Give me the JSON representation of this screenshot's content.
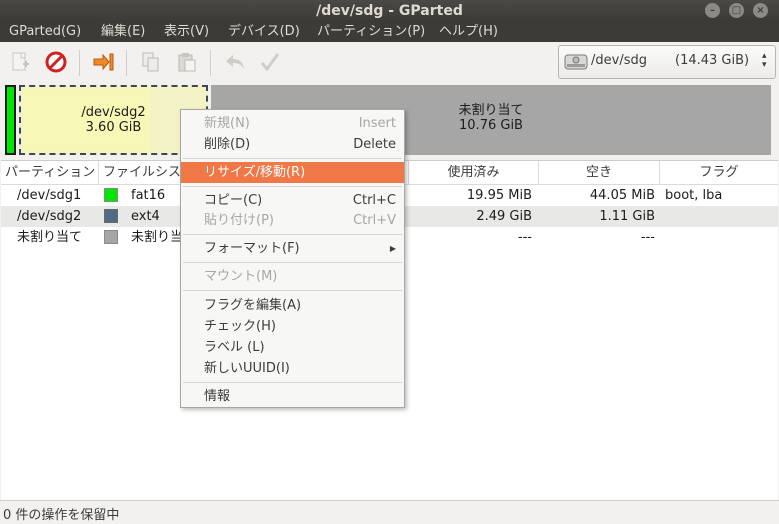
{
  "window": {
    "title": "/dev/sdg - GParted"
  },
  "menubar": {
    "items": [
      "GParted(G)",
      "編集(E)",
      "表示(V)",
      "デバイス(D)",
      "パーティション(P)",
      "ヘルプ(H)"
    ]
  },
  "device": {
    "name": "/dev/sdg",
    "size": "(14.43 GiB)"
  },
  "bars": {
    "sdg2": {
      "name": "/dev/sdg2",
      "size": "3.60 GiB"
    },
    "unallocated": {
      "name": "未割り当て",
      "size": "10.76 GiB"
    }
  },
  "table": {
    "headers": [
      "パーティション",
      "ファイルシス",
      "使用済み",
      "空き",
      "フラグ"
    ],
    "rows": [
      {
        "partition": "/dev/sdg1",
        "fs": "fat16",
        "color": "#00e600",
        "used": "19.95 MiB",
        "free": "44.05 MiB",
        "flags": "boot, lba"
      },
      {
        "partition": "/dev/sdg2",
        "fs": "ext4",
        "color": "#4f6b86",
        "used": "2.49 GiB",
        "free": "1.11 GiB",
        "flags": ""
      },
      {
        "partition": "未割り当て",
        "fs": "未割り当",
        "color": "#a6a6a6",
        "used": "---",
        "free": "---",
        "flags": ""
      }
    ]
  },
  "context_menu": {
    "new": {
      "label": "新規(N)",
      "accel": "Insert"
    },
    "delete": {
      "label": "削除(D)",
      "accel": "Delete"
    },
    "resize": {
      "label": "リサイズ/移動(R)"
    },
    "copy": {
      "label": "コピー(C)",
      "accel": "Ctrl+C"
    },
    "paste": {
      "label": "貼り付け(P)",
      "accel": "Ctrl+V"
    },
    "format": {
      "label": "フォーマット(F)"
    },
    "mount": {
      "label": "マウント(M)"
    },
    "flags": {
      "label": "フラグを編集(A)"
    },
    "check": {
      "label": "チェック(H)"
    },
    "label": {
      "label": "ラベル (L)"
    },
    "uuid": {
      "label": "新しいUUID(I)"
    },
    "info": {
      "label": "情報"
    }
  },
  "status": {
    "text": "0 件の操作を保留中"
  },
  "colors": {
    "accent": "#f07746",
    "titlebar": "#3c3b37",
    "fat16": "#00e600",
    "ext4": "#4f6b86",
    "unallocated": "#a6a6a6"
  },
  "icons": [
    "new-icon",
    "delete-icon",
    "resize-icon",
    "copy-icon",
    "paste-icon",
    "undo-icon",
    "apply-icon",
    "disk-icon"
  ]
}
